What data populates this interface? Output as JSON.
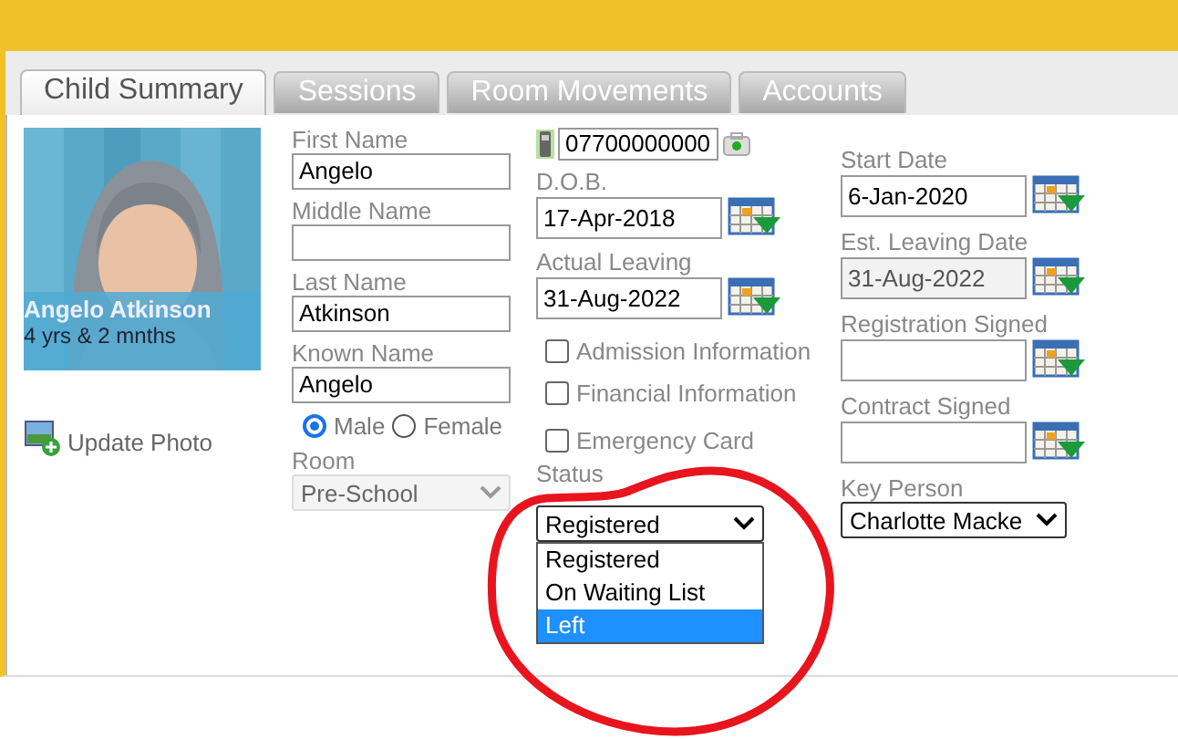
{
  "tabs": [
    {
      "label": "Child Summary",
      "selected": true
    },
    {
      "label": "Sessions",
      "selected": false
    },
    {
      "label": "Room Movements",
      "selected": false
    },
    {
      "label": "Accounts",
      "selected": false
    }
  ],
  "photo": {
    "name": "Angelo Atkinson",
    "age": "4 yrs & 2 mnths",
    "update_label": "Update Photo"
  },
  "personal": [
    {
      "label": "First Name",
      "value": "Angelo"
    },
    {
      "label": "Middle Name"
    },
    {
      "label": "Last Name",
      "value": "Atkinson"
    },
    {
      "label": "Known Name",
      "value": "Angelo"
    }
  ],
  "gender": [
    {
      "label": "Male",
      "selected": true
    },
    {
      "label": "Female",
      "selected": false
    }
  ],
  "room": {
    "label": "Room",
    "value": "Pre-School",
    "disabled": true
  },
  "phone": {
    "value": "07700000000"
  },
  "dates_left": [
    {
      "label": "D.O.B.",
      "value": "17-Apr-2018",
      "disabled": false
    },
    {
      "label": "Actual Leaving",
      "value": "31-Aug-2022",
      "disabled": false
    }
  ],
  "checks": [
    {
      "label": "Admission Information",
      "checked": false
    },
    {
      "label": "Financial Information",
      "checked": false
    },
    {
      "label": "Emergency Card",
      "checked": false
    }
  ],
  "status": {
    "label": "Status",
    "value": "Registered",
    "expanded": true,
    "options": [
      {
        "label": "Registered",
        "highlighted": false
      },
      {
        "label": "On Waiting List",
        "highlighted": false
      },
      {
        "label": "Left",
        "highlighted": true
      }
    ]
  },
  "dates_right": [
    {
      "label": "Start Date",
      "value": "6-Jan-2020",
      "disabled": false
    },
    {
      "label": "Est. Leaving Date",
      "value": "31-Aug-2022",
      "disabled": true
    },
    {
      "label": "Registration Signed",
      "disabled": false
    },
    {
      "label": "Contract Signed",
      "disabled": false
    }
  ],
  "key_person": {
    "label": "Key Person",
    "value": "Charlotte Macke"
  }
}
